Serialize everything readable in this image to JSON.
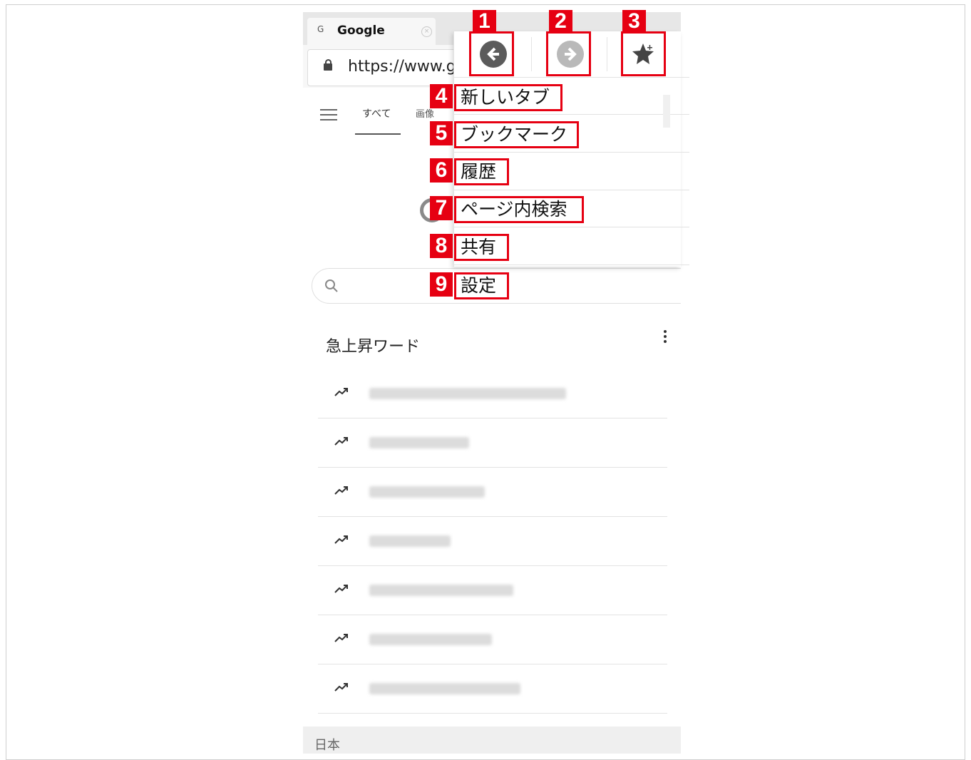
{
  "browser": {
    "tab_favicon": "G",
    "tab_title": "Google",
    "tab_close": "×",
    "url": "https://www.g"
  },
  "google": {
    "tab_all": "すべて",
    "tab_images": "画像",
    "trending_title": "急上昇ワード",
    "footer_region": "日本"
  },
  "menu": {
    "back_icon": "arrow-left-icon",
    "forward_icon": "arrow-right-icon",
    "bookmark_icon": "star-add-icon",
    "items": [
      "新しいタブ",
      "ブックマーク",
      "履歴",
      "ページ内検索",
      "共有",
      "設定"
    ]
  },
  "annotations": {
    "badges": [
      "1",
      "2",
      "3",
      "4",
      "5",
      "6",
      "7",
      "8",
      "9"
    ],
    "color": "#e60012"
  }
}
